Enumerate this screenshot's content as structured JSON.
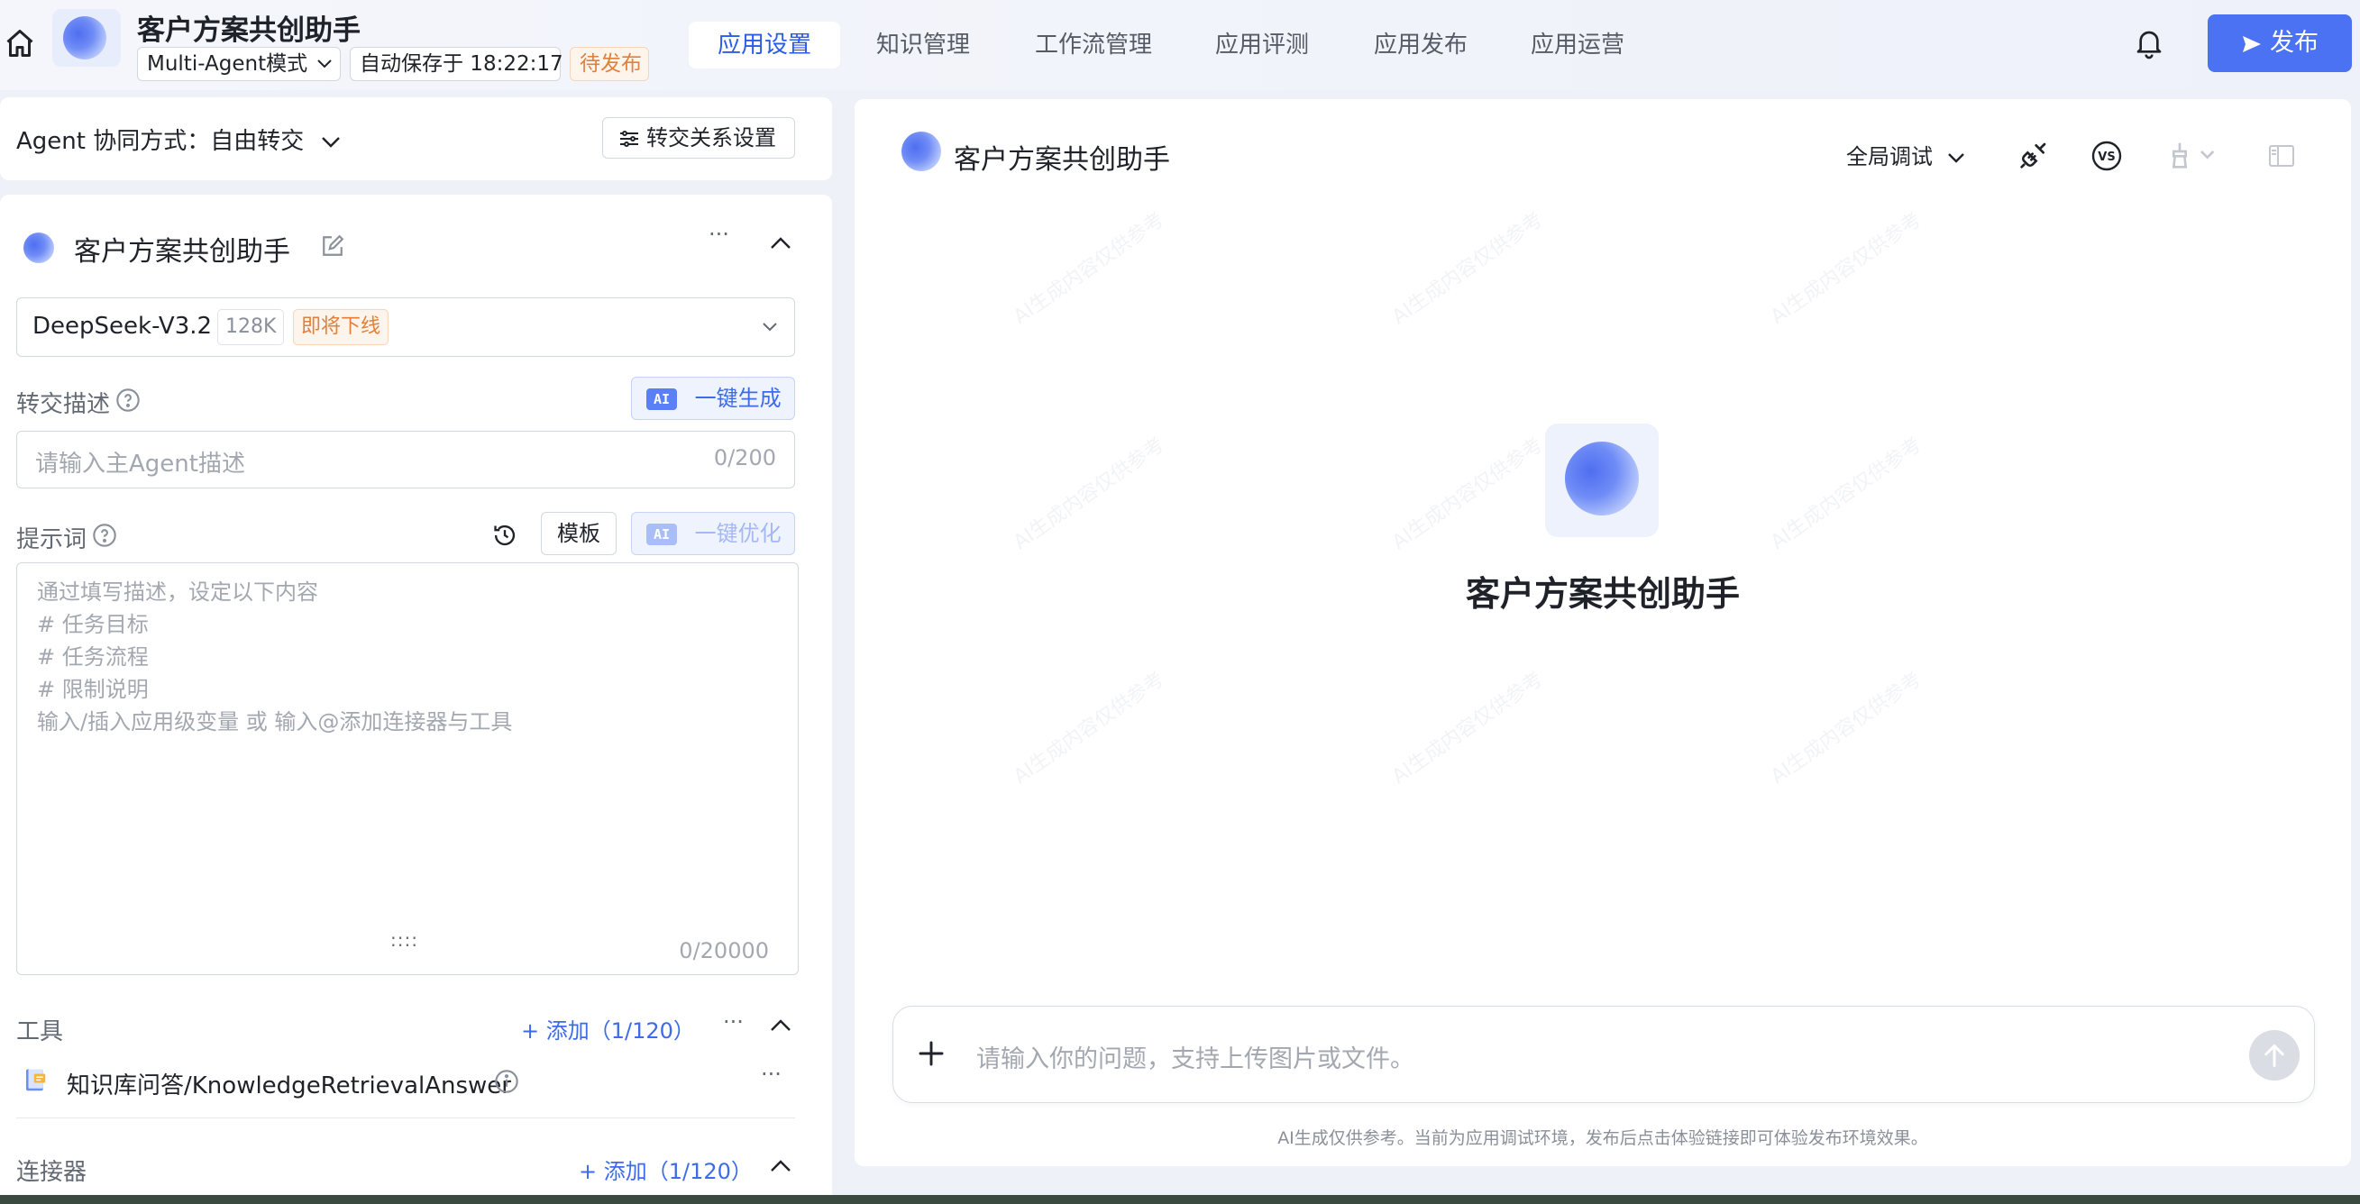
{
  "header": {
    "app_title": "客户方案共创助手",
    "mode": "Multi-Agent模式",
    "autosave": "自动保存于 18:22:17",
    "status": "待发布",
    "tabs": [
      "应用设置",
      "知识管理",
      "工作流管理",
      "应用评测",
      "应用发布",
      "应用运营"
    ],
    "active_tab": 0,
    "publish_label": "发布"
  },
  "collab": {
    "label": "Agent 协同方式：自由转交",
    "handoff_button": "转交关系设置"
  },
  "agent": {
    "name": "客户方案共创助手",
    "more": "···",
    "model": {
      "name": "DeepSeek-V3.2",
      "context": "128K",
      "badge": "即将下线"
    },
    "handoff_desc": {
      "label": "转交描述",
      "ai_button": "一键生成",
      "ai_tag": "AI",
      "placeholder": "请输入主Agent描述",
      "counter": "0/200"
    },
    "prompt": {
      "label": "提示词",
      "template_button": "模板",
      "ai_button": "一键优化",
      "ai_tag": "AI",
      "placeholder_lines": [
        "通过填写描述，设定以下内容",
        "# 任务目标",
        "# 任务流程",
        "# 限制说明",
        "输入/插入应用级变量 或 输入@添加连接器与工具"
      ],
      "resize_handle": "::::",
      "counter": "0/20000"
    },
    "tools": {
      "label": "工具",
      "add": "+ 添加（1/120）",
      "more": "···",
      "items": [
        {
          "name": "知识库问答/KnowledgeRetrievalAnswer",
          "more": "···"
        }
      ]
    },
    "connectors": {
      "label": "连接器",
      "add": "+ 添加（1/120）"
    }
  },
  "chat": {
    "title": "客户方案共创助手",
    "debug_mode": "全局调试",
    "center_title": "客户方案共创助手",
    "watermark": "AI生成内容仅供参考",
    "input_placeholder": "请输入你的问题，支持上传图片或文件。",
    "footer_note": "AI生成仅供参考。当前为应用调试环境，发布后点击体验链接即可体验发布环境效果。"
  },
  "colors": {
    "accent": "#4b72f2",
    "active_tab_text": "#2b5ce6",
    "pending": "#e0803a"
  },
  "icons": [
    "home-icon",
    "bell-icon",
    "send-icon",
    "chevron-down-icon",
    "sliders-icon",
    "edit-icon",
    "help-icon",
    "history-icon",
    "plug-icon",
    "vs-icon",
    "broom-icon",
    "sidebar-icon",
    "plus-icon",
    "arrow-up-icon",
    "info-icon",
    "knowledge-book-icon",
    "collapse-left-icon",
    "chevron-up-icon"
  ]
}
